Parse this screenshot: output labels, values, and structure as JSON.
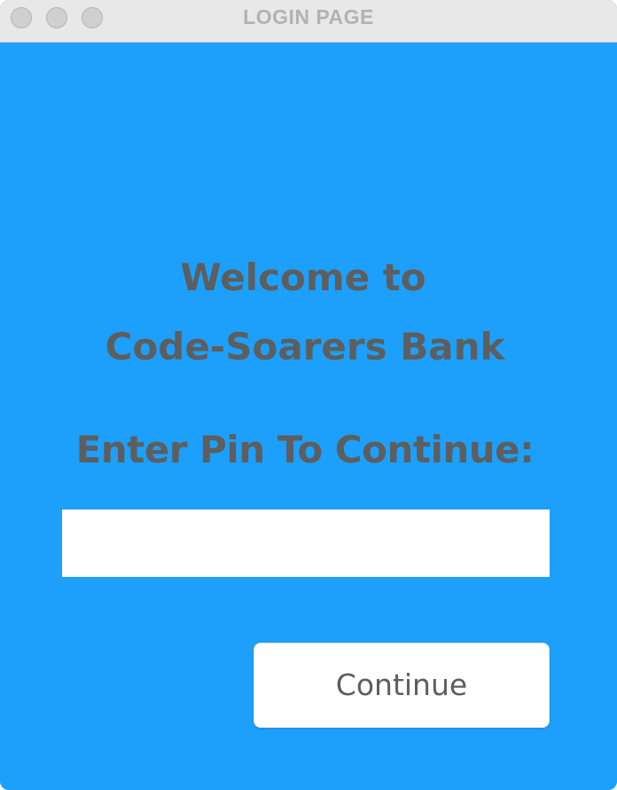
{
  "window": {
    "title": "LOGIN PAGE",
    "controls": [
      "close",
      "minimize",
      "zoom"
    ]
  },
  "main": {
    "welcome_line_1": "Welcome to",
    "welcome_line_2": "Code-Soarers Bank",
    "pin_label": "Enter Pin To Continue:",
    "pin_input": {
      "value": "",
      "placeholder": ""
    },
    "continue_label": "Continue"
  },
  "colors": {
    "background": "#1ca0fc",
    "text": "#5e5e5e",
    "titlebar": "#e8e8e8",
    "title_text": "#b2b2b2"
  }
}
